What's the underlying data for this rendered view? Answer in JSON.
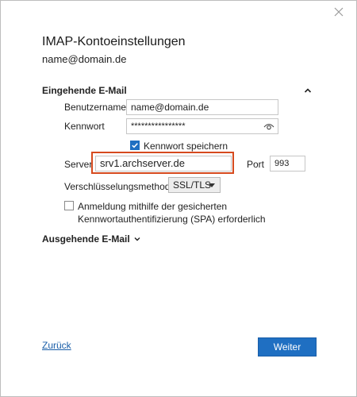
{
  "dialog": {
    "title": "IMAP-Kontoeinstellungen",
    "account": "name@domain.de",
    "close_icon": "close-icon"
  },
  "incoming": {
    "heading": "Eingehende E-Mail",
    "collapse_icon": "chevron-up-icon",
    "username_label": "Benutzername",
    "username_value": "name@domain.de",
    "password_label": "Kennwort",
    "password_value": "****************",
    "show_password_icon": "eye-icon",
    "remember_label": "Kennwort speichern",
    "remember_checked": true,
    "server_label": "Server",
    "server_value": "srv1.archserver.de",
    "port_label": "Port",
    "port_value": "993",
    "encryption_label": "Verschlüsselungsmethode",
    "encryption_value": "SSL/TLS",
    "spa_label_line1": "Anmeldung mithilfe der gesicherten",
    "spa_label_line2": "Kennwortauthentifizierung (SPA) erforderlich",
    "spa_checked": false
  },
  "outgoing": {
    "heading": "Ausgehende E-Mail",
    "expand_icon": "chevron-down-icon"
  },
  "footer": {
    "back_label": "Zurück",
    "next_label": "Weiter"
  },
  "colors": {
    "accent": "#1f6fc2",
    "highlight_border": "#d64a1e"
  }
}
